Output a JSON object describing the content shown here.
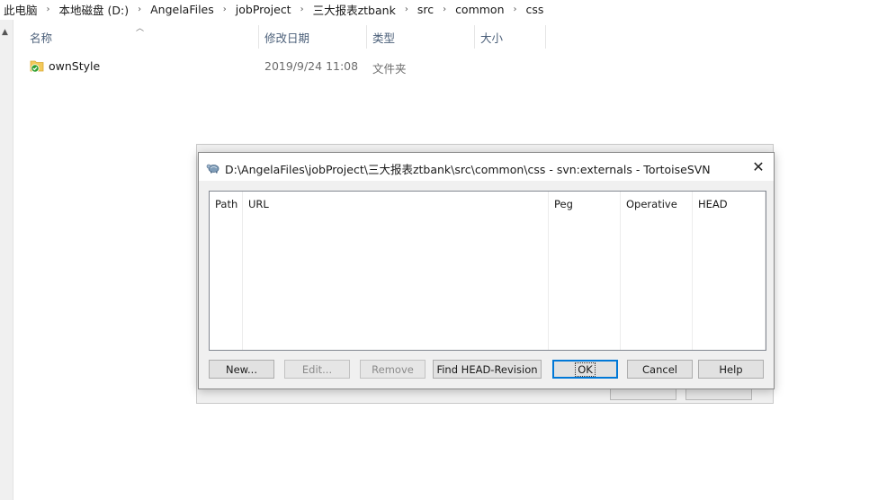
{
  "breadcrumb": [
    "此电脑",
    "本地磁盘 (D:)",
    "AngelaFiles",
    "jobProject",
    "三大报表ztbank",
    "src",
    "common",
    "css"
  ],
  "columns": {
    "name": "名称",
    "date": "修改日期",
    "type": "类型",
    "size": "大小"
  },
  "files": [
    {
      "name": "ownStyle",
      "date": "2019/9/24 11:08",
      "type": "文件夹"
    }
  ],
  "dialog": {
    "title": "D:\\AngelaFiles\\jobProject\\三大报表ztbank\\src\\common\\css - svn:externals - TortoiseSVN",
    "close": "✕",
    "columns": {
      "path": "Path",
      "url": "URL",
      "peg": "Peg",
      "operative": "Operative",
      "head": "HEAD"
    },
    "buttons": {
      "new": "New...",
      "edit": "Edit...",
      "remove": "Remove",
      "find_head": "Find HEAD-Revision",
      "ok": "OK",
      "cancel": "Cancel",
      "help": "Help"
    }
  },
  "colors": {
    "header_text": "#4c607a",
    "accent": "#0078d7",
    "folder": "#f3c95a",
    "svn_ok": "#2e9e2e"
  },
  "icons": {
    "folder": "folder-svn-ok-icon",
    "dialog": "tortoisesvn-icon"
  }
}
